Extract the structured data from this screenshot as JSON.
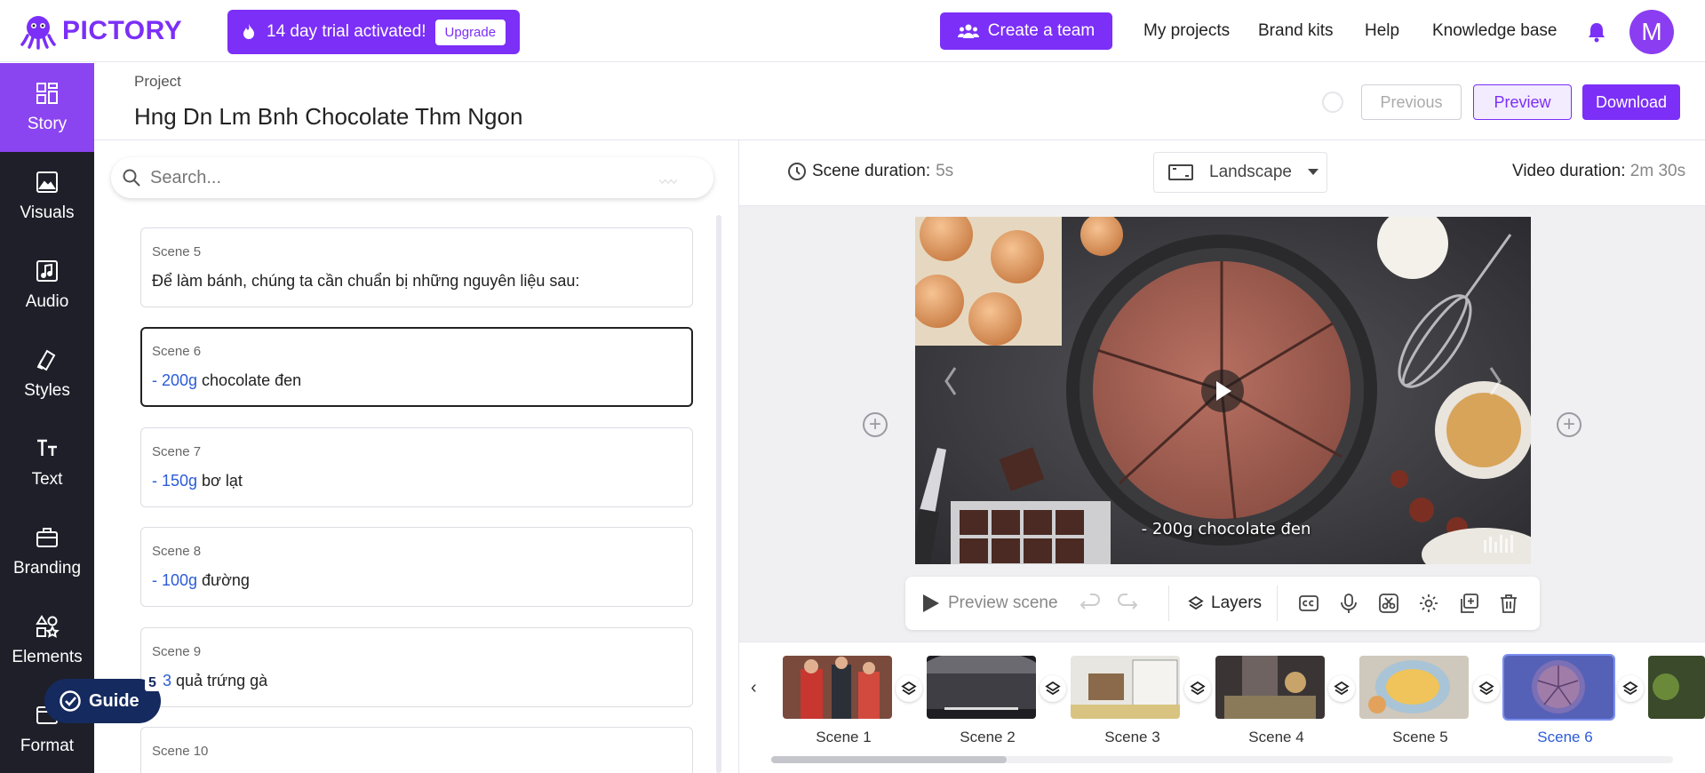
{
  "app": {
    "brand": "PICTORY"
  },
  "banner": {
    "trial_text": "14 day trial activated!",
    "upgrade_label": "Upgrade"
  },
  "topnav": {
    "create_team": "Create a team",
    "links": [
      "My projects",
      "Brand kits",
      "Help",
      "Knowledge base"
    ],
    "avatar_initial": "M"
  },
  "sidebar": {
    "items": [
      {
        "label": "Story",
        "icon": "story-icon",
        "active": true
      },
      {
        "label": "Visuals",
        "icon": "image-icon"
      },
      {
        "label": "Audio",
        "icon": "music-icon"
      },
      {
        "label": "Styles",
        "icon": "styles-icon"
      },
      {
        "label": "Text",
        "icon": "text-icon"
      },
      {
        "label": "Branding",
        "icon": "briefcase-icon"
      },
      {
        "label": "Elements",
        "icon": "elements-icon"
      },
      {
        "label": "Format",
        "icon": "format-icon"
      }
    ]
  },
  "project": {
    "label": "Project",
    "title": "Hng Dn Lm Bnh Chocolate Thm Ngon",
    "prev_label": "Previous",
    "preview_label": "Preview",
    "download_label": "Download"
  },
  "search": {
    "placeholder": "Search..."
  },
  "scenes": [
    {
      "label": "Scene 5",
      "num": "",
      "text": "Để làm bánh, chúng ta cần chuẩn bị những nguyên liệu sau:"
    },
    {
      "label": "Scene 6",
      "prefix": "- ",
      "num": "200g",
      "text": " chocolate đen",
      "active": true
    },
    {
      "label": "Scene 7",
      "prefix": "- ",
      "num": "150g",
      "text": " bơ lạt"
    },
    {
      "label": "Scene 8",
      "prefix": "- ",
      "num": "100g",
      "text": " đường"
    },
    {
      "label": "Scene 9",
      "prefix": "",
      "num": "3",
      "text": " quả trứng gà"
    },
    {
      "label": "Scene 10",
      "prefix": "",
      "num": "",
      "text": ""
    }
  ],
  "guide": {
    "label": "Guide",
    "badge": "5"
  },
  "workspace": {
    "scene_duration_label": "Scene duration:",
    "scene_duration_value": "5s",
    "orientation": "Landscape",
    "video_duration_label": "Video duration:",
    "video_duration_value": "2m 30s",
    "caption": "- 200g chocolate đen"
  },
  "toolbar": {
    "preview_scene": "Preview scene",
    "layers": "Layers"
  },
  "timeline": {
    "scenes": [
      "Scene 1",
      "Scene 2",
      "Scene 3",
      "Scene 4",
      "Scene 5",
      "Scene 6"
    ],
    "active_index": 5
  },
  "colors": {
    "brand": "#7b2ff7",
    "sidebar_bg": "#1f1f2a",
    "sidebar_active": "#8a44f0",
    "link_blue": "#2b5bd7",
    "guide_bg": "#152a5e"
  }
}
